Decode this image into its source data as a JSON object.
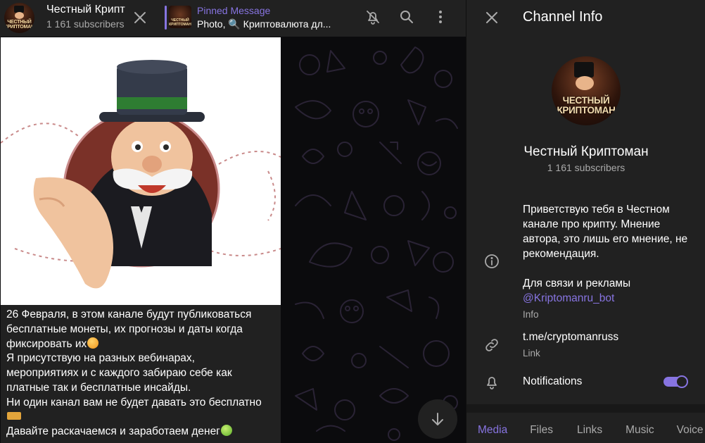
{
  "header": {
    "channel_name": "Честный Крипт",
    "subscribers": "1 161 subscribers",
    "avatar_text": "ЧЕСТНЫЙ КРИПТОМАН",
    "pinned": {
      "title": "Pinned Message",
      "text": "Photo, 🔍 Криптовалюта дл..."
    },
    "icons": {
      "close": "close-icon",
      "mute": "bell-off-icon",
      "search": "search-icon",
      "more": "more-vertical-icon"
    }
  },
  "post": {
    "lines": [
      "26 Февраля, в этом канале будут публиковаться",
      "бесплатные монеты, их прогнозы и даты когда",
      "фиксировать их",
      "Я присутствую на разных вебинарах,",
      "мероприятиях и с каждого забираю себе как",
      "платные так и бесплатные инсайды.",
      "Ни один канал вам не будет давать это бесплатно",
      "",
      "Давайте раскачаемся и заработаем денег"
    ]
  },
  "info_panel": {
    "title": "Channel Info",
    "name": "Честный Криптоман",
    "subscribers": "1 161 subscribers",
    "avatar_text": "ЧЕСТНЫЙ КРИПТОМАН",
    "description_p1": "Приветствую тебя в Честном канале про крипту. Мнение автора, это лишь его мнение, не рекомендация.",
    "description_p2": "Для связи и рекламы",
    "description_link": "@Kriptomanru_bot",
    "description_caption": "Info",
    "link_value": "t.me/cryptomanruss",
    "link_caption": "Link",
    "notifications_label": "Notifications",
    "notifications_on": true,
    "tabs": [
      "Media",
      "Files",
      "Links",
      "Music",
      "Voice"
    ],
    "active_tab": "Media"
  },
  "colors": {
    "accent": "#8774e1",
    "panel": "#212121",
    "background": "#0f0f0f",
    "secondary_text": "#aaaaaa"
  }
}
